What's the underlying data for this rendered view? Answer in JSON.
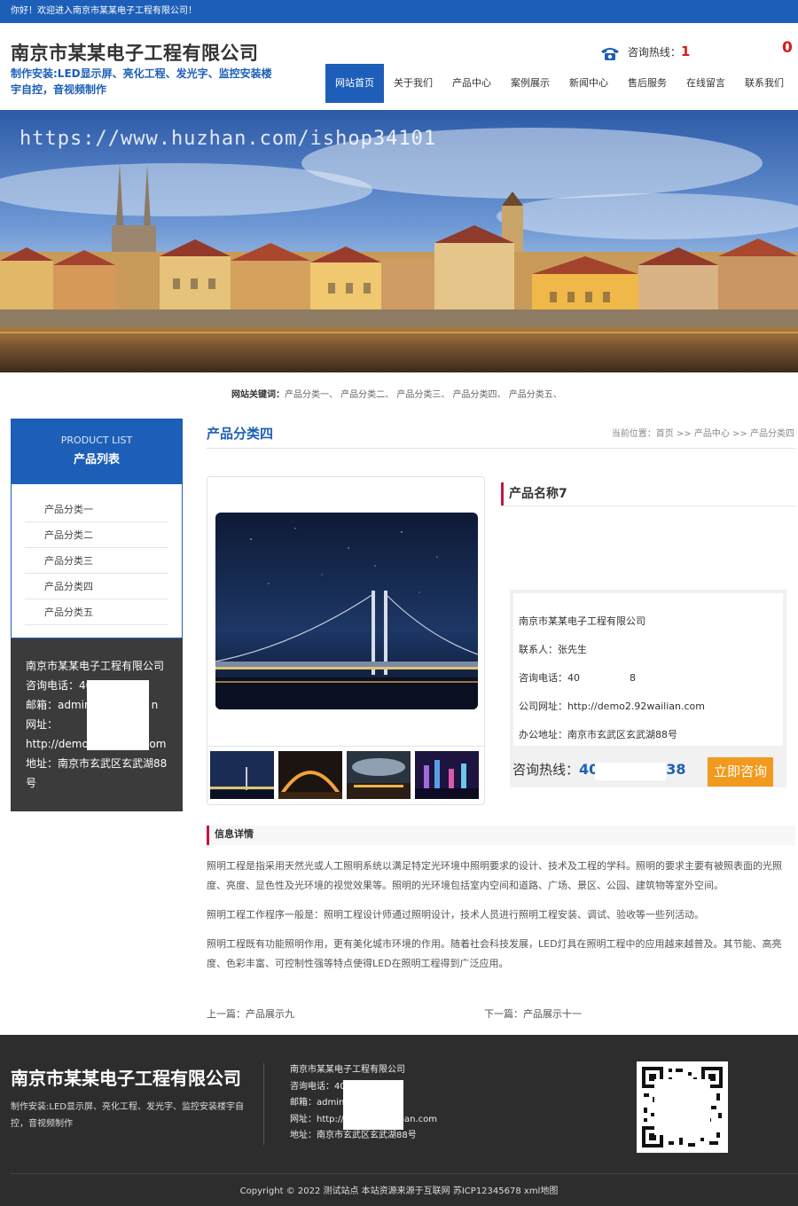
{
  "topbar": {
    "welcome": "你好！欢迎进入南京市某某电子工程有限公司！"
  },
  "header": {
    "company": "南京市某某电子工程有限公司",
    "slogan": "制作安装:LED显示屏、亮化工程、发光字、监控安装楼宇自控，音视频制作",
    "hotline_label": "咨询热线：",
    "hotline_number": "1",
    "hotline_tail": "0"
  },
  "nav": [
    {
      "label": "网站首页",
      "active": true
    },
    {
      "label": "关于我们"
    },
    {
      "label": "产品中心"
    },
    {
      "label": "案例展示"
    },
    {
      "label": "新闻中心"
    },
    {
      "label": "售后服务"
    },
    {
      "label": "在线留言"
    },
    {
      "label": "联系我们"
    }
  ],
  "banner": {
    "watermark": "https://www.huzhan.com/ishop34101"
  },
  "keywords": {
    "label": "网站关键词：",
    "items": "产品分类一、 产品分类二、 产品分类三、 产品分类四、 产品分类五、"
  },
  "sidebar": {
    "title_en": "PRODUCT LIST",
    "title_cn": "产品列表",
    "items": [
      "产品分类一",
      "产品分类二",
      "产品分类三",
      "产品分类四",
      "产品分类五"
    ],
    "contact": {
      "company": "南京市某某电子工程有限公司",
      "phone": "咨询电话：40",
      "email": "邮箱：admin",
      "email_tail": "n",
      "website_label": "网址：",
      "website": "http://demo",
      "website_tail": "com",
      "address": "地址：南京市玄武区玄武湖88号"
    }
  },
  "content": {
    "category_title": "产品分类四",
    "breadcrumb": "当前位置：首页 >> 产品中心 >> 产品分类四",
    "product_name": "产品名称7",
    "info": {
      "company": "南京市某某电子工程有限公司",
      "contact": "联系人：张先生",
      "phone": "咨询电话：40",
      "phone_tail": "8",
      "website": "公司网址：http://demo2.92wailian.com",
      "address": "办公地址：南京市玄武区玄武湖88号"
    },
    "consult": {
      "label": "咨询热线：",
      "number_head": "40",
      "number_tail": "38",
      "button": "立即咨询"
    },
    "detail_title": "信息详情",
    "detail_paragraphs": [
      "照明工程是指采用天然光或人工照明系统以满足特定光环境中照明要求的设计、技术及工程的学科。照明的要求主要有被照表面的光照度、亮度、显色性及光环境的视觉效果等。照明的光环境包括室内空间和道路、广场、景区、公园、建筑物等室外空间。",
      "照明工程工作程序一般是：照明工程设计师通过照明设计，技术人员进行照明工程安装、调试、验收等一些列活动。",
      "照明工程既有功能照明作用，更有美化城市环境的作用。随着社会科技发展，LED灯具在照明工程中的应用越来越普及。其节能、高亮度、色彩丰富、可控制性强等特点使得LED在照明工程得到广泛应用。"
    ],
    "prev": "上一篇：产品展示九",
    "next": "下一篇：产品展示十一"
  },
  "footer": {
    "company": "南京市某某电子工程有限公司",
    "slogan": "制作安装:LED显示屏、亮化工程、发光字、监控安装楼宇自控，音视频制作",
    "contact_company": "南京市某某电子工程有限公司",
    "phone": "咨询电话：40",
    "email": "邮箱：admin",
    "website": "网址：http://",
    "website_tail": "ilian.com",
    "address": "地址：南京市玄武区玄武湖88号",
    "copyright": "Copyright © 2022 测试站点 本站资源来源于互联网   苏ICP12345678   xml地图"
  },
  "icons": {
    "hotline": "phone-icon",
    "qr": "qr-code-icon"
  },
  "colors": {
    "brand": "#1d5fb8",
    "accent": "#c4163f",
    "button": "#f19a1d",
    "footer": "#2d2d2d"
  }
}
